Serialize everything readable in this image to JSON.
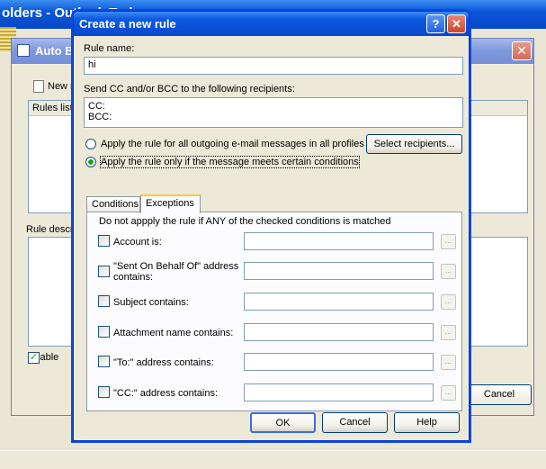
{
  "background": {
    "window_title": "olders - Outlook Today"
  },
  "auto_bcc": {
    "title": "Auto BC",
    "new_label": "New r",
    "rules_list_header": "Rules list",
    "rule_description_label": "Rule descri",
    "enable_label": "Enable",
    "cancel_label": "Cancel"
  },
  "dialog": {
    "title": "Create a new rule",
    "help_glyph": "?",
    "close_glyph": "✕",
    "rule_name_label": "Rule name:",
    "rule_name_value": "hi",
    "send_cc_label": "Send CC and/or BCC to the following recipients:",
    "recipients_text": "CC:\nBCC:",
    "radio_all": "Apply the rule for all outgoing e-mail messages in all profiles",
    "radio_conditions": "Apply the rule only if the message meets certain conditions",
    "select_recipients_button": "Select recipients...",
    "tabs": [
      {
        "label": "Conditions",
        "active": false
      },
      {
        "label": "Exceptions",
        "active": true
      }
    ],
    "exceptions_header": "Do not appply the rule if ANY of the checked conditions is matched",
    "conditions": [
      {
        "label": "Account is:",
        "value": ""
      },
      {
        "label": "\"Sent On Behalf Of\" address contains:",
        "value": ""
      },
      {
        "label": "Subject contains:",
        "value": ""
      },
      {
        "label": "Attachment name contains:",
        "value": ""
      },
      {
        "label": "\"To:\" address contains:",
        "value": ""
      },
      {
        "label": "\"CC:\" address contains:",
        "value": ""
      }
    ],
    "ellipsis_label": "...",
    "ok_button": "OK",
    "cancel_button": "Cancel",
    "help_button": "Help"
  }
}
